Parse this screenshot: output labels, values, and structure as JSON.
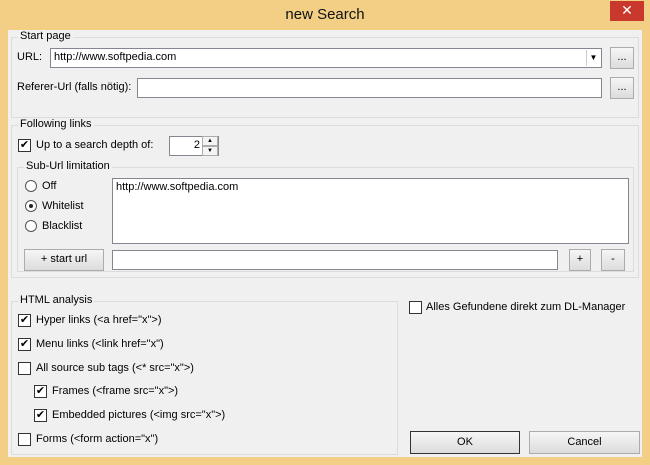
{
  "window": {
    "title": "new Search",
    "close_glyph": "✕"
  },
  "start_page": {
    "legend": "Start page",
    "url_label": "URL:",
    "url_value": "http://www.softpedia.com",
    "browse_label": "...",
    "referer_label": "Referer-Url (falls nötig):",
    "referer_value": ""
  },
  "following": {
    "legend": "Following links",
    "depth_label": "Up to a search depth of:",
    "depth_value": "2",
    "sub_url": {
      "legend": "Sub-Url limitation",
      "options": [
        {
          "label": "Off",
          "selected": false
        },
        {
          "label": "Whitelist",
          "selected": true
        },
        {
          "label": "Blacklist",
          "selected": false
        }
      ],
      "list_items": [
        "http://www.softpedia.com"
      ],
      "start_url_button": "+ start url",
      "new_url_value": "",
      "add_button": "+",
      "remove_button": "-"
    }
  },
  "html_analysis": {
    "legend": "HTML analysis",
    "hyper_links": "Hyper links (<a href=\"x\">)",
    "menu_links": "Menu links (<link href=\"x\")",
    "all_source": "All source sub tags (<* src=\"x\">)",
    "frames": "Frames (<frame src=\"x\">)",
    "embedded_pictures": "Embedded pictures (<img src=\"x\">)",
    "forms": "Forms (<form action=\"x\")"
  },
  "dl_manager_label": "Alles Gefundene direkt zum DL-Manager",
  "buttons": {
    "ok": "OK",
    "cancel": "Cancel"
  }
}
